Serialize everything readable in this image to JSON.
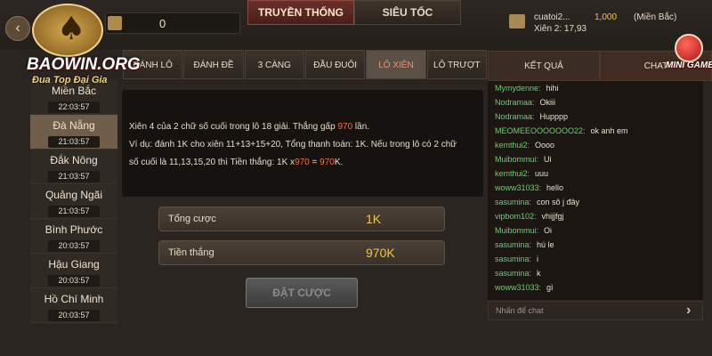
{
  "header": {
    "back_icon": "back-arrow-icon",
    "logo_text": "BAOWIN.ORG",
    "logo_slogan": "Đua Top Đại Gia",
    "balance": "0",
    "mode_tabs": [
      {
        "label": "TRUYỀN THỐNG",
        "active": true
      },
      {
        "label": "SIÊU TỐC",
        "active": false
      }
    ],
    "user": {
      "name": "cuatoi2...",
      "amount": "1,000",
      "region": "(Miền Bắc)",
      "xien": "Xiên 2: 17,93"
    },
    "minigame_label": "MINI GAME"
  },
  "regions": [
    {
      "name": "Miền Bắc",
      "time": "22:03:57",
      "active": false
    },
    {
      "name": "Đà Nẵng",
      "time": "21:03:57",
      "active": true
    },
    {
      "name": "Đắk Nông",
      "time": "21:03:57",
      "active": false
    },
    {
      "name": "Quảng Ngãi",
      "time": "21:03:57",
      "active": false
    },
    {
      "name": "Bình Phước",
      "time": "20:03:57",
      "active": false
    },
    {
      "name": "Hậu Giang",
      "time": "20:03:57",
      "active": false
    },
    {
      "name": "Hồ Chí Minh",
      "time": "20:03:57",
      "active": false
    }
  ],
  "bet_tabs": [
    {
      "label": "ĐÁNH LÔ",
      "active": false
    },
    {
      "label": "ĐÁNH ĐỀ",
      "active": false
    },
    {
      "label": "3 CÀNG",
      "active": false
    },
    {
      "label": "ĐẦU ĐUÔI",
      "active": false
    },
    {
      "label": "LÔ XIÊN",
      "active": true
    },
    {
      "label": "LÔ TRƯỢT",
      "active": false
    }
  ],
  "description": {
    "line1_a": "Xiên 4 của 2 chữ số cuối trong lô 18 giải. Thắng gấp ",
    "line1_hl": "970",
    "line1_b": " lần.",
    "line2": "Ví dụ: đánh 1K cho xiên 11+13+15+20, Tổng thanh toán: 1K. Nếu trong lô có 2 chữ",
    "line3_a": "số cuối là 11,13,15,20 thì Tiền thắng: 1K x",
    "line3_hl1": "970",
    "line3_b": " = ",
    "line3_hl2": "970",
    "line3_c": "K."
  },
  "totals": {
    "total_label": "Tổng cược",
    "total_value": "1K",
    "win_label": "Tiền thắng",
    "win_value": "970K"
  },
  "place_bet_label": "ĐẶT CƯỢC",
  "side_tabs": [
    {
      "label": "KẾT QUẢ",
      "active": false
    },
    {
      "label": "CHAT",
      "active": true
    }
  ],
  "chat": [
    {
      "user": "Mymydenne:",
      "text": "hihi"
    },
    {
      "user": "Nodramaa:",
      "text": "Okiii"
    },
    {
      "user": "Nodramaa:",
      "text": "Hupppp"
    },
    {
      "user": "MEOMEEOOOOOOO22:",
      "text": "ok anh em"
    },
    {
      "user": "kemthui2:",
      "text": "Oooo"
    },
    {
      "user": "Muibommui:",
      "text": "Ui"
    },
    {
      "user": "kemthui2:",
      "text": "uuu"
    },
    {
      "user": "woww31033:",
      "text": "hello"
    },
    {
      "user": "sasumina:",
      "text": "con sô j đây"
    },
    {
      "user": "vipbom102:",
      "text": "vhijjfgj"
    },
    {
      "user": "Muibommui:",
      "text": "Oi"
    },
    {
      "user": "sasumina:",
      "text": "hú le"
    },
    {
      "user": "sasumina:",
      "text": "i"
    },
    {
      "user": "sasumina:",
      "text": "k"
    },
    {
      "user": "woww31033:",
      "text": "gì"
    }
  ],
  "chat_placeholder": "Nhấn để chat",
  "send_icon": "send-arrow-icon",
  "colors": {
    "accent": "#f3c54b",
    "highlight": "#ff6a3d",
    "chat_user": "#6cd06c",
    "active_tab": "#6a2f2a"
  }
}
